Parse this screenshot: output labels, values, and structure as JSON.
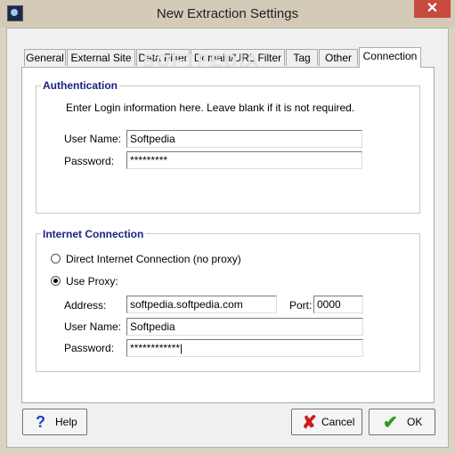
{
  "window": {
    "title": "New Extraction Settings",
    "close_label": "✕"
  },
  "tabs": [
    {
      "label": "General"
    },
    {
      "label": "External Site *"
    },
    {
      "label": "Data Filter"
    },
    {
      "label": "Domain/URL Filter *"
    },
    {
      "label": "Tag"
    },
    {
      "label": "Other"
    },
    {
      "label": "Connection",
      "active": true
    }
  ],
  "watermark": "SOFTPEDIA",
  "authentication": {
    "legend": "Authentication",
    "info": "Enter Login information here. Leave blank if it is not required.",
    "username_label": "User Name:",
    "username_value": "Softpedia",
    "password_label": "Password:",
    "password_value": "*********"
  },
  "internet": {
    "legend": "Internet Connection",
    "direct_label": "Direct Internet Connection (no proxy)",
    "proxy_label": "Use Proxy:",
    "selected": "proxy",
    "address_label": "Address:",
    "address_value": "softpedia.softpedia.com",
    "port_label": "Port:",
    "port_value": "0000",
    "username_label": "User Name:",
    "username_value": "Softpedia",
    "password_label": "Password:",
    "password_value": "************|"
  },
  "buttons": {
    "help": "Help",
    "cancel": "Cancel",
    "ok": "OK"
  },
  "icons": {
    "help": "?",
    "cancel": "✘",
    "ok": "✔"
  }
}
